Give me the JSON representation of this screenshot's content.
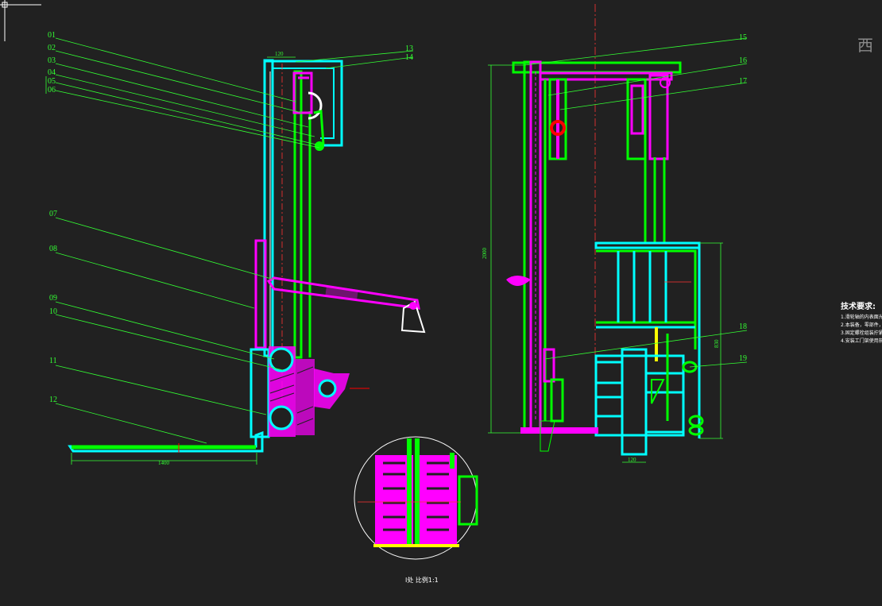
{
  "viewcube": {
    "label": "西"
  },
  "callouts": {
    "left": [
      "01",
      "02",
      "03",
      "04",
      "05",
      "06",
      "07",
      "08",
      "09",
      "10",
      "11",
      "12"
    ],
    "right": [
      "13",
      "14",
      "15",
      "16",
      "17",
      "18",
      "19"
    ]
  },
  "dimensions": {
    "top_width": "120",
    "fork_length": "1400",
    "overall_height": "2000",
    "carriage_height": "830",
    "bottom_width": "120"
  },
  "tech_notes": {
    "title": "技术要求:",
    "lines": [
      "1.滑轮轴的内表面光",
      "2.本装备，零部件，",
      "3.固定螺栓组装拧紧",
      "4.安装工门架使用前"
    ]
  },
  "detail_caption": "I处 比例1:1",
  "colors": {
    "background": "#212121",
    "cyan": "#00ffff",
    "green": "#00ff00",
    "magenta": "#ff00ff",
    "leader": "#33ff33",
    "red": "#ff0000",
    "yellow": "#ffff00",
    "white": "#ffffff"
  }
}
